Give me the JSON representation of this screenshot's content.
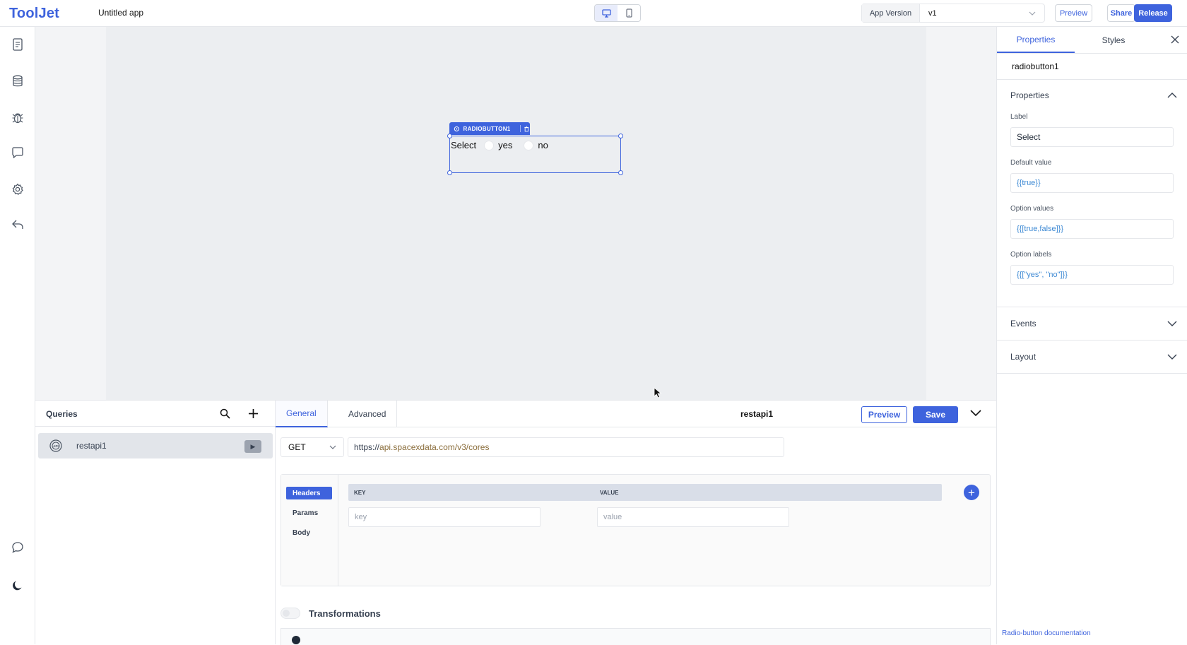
{
  "header": {
    "logo": "ToolJet",
    "app_name": "Untitled app",
    "app_version_label": "App Version",
    "app_version_value": "v1",
    "preview": "Preview",
    "share": "Share",
    "release": "Release"
  },
  "canvas": {
    "widget_tag": "RADIOBUTTON1",
    "radio": {
      "label": "Select",
      "options": [
        "yes",
        "no"
      ]
    }
  },
  "queries": {
    "title": "Queries",
    "items": [
      {
        "name": "restapi1",
        "icon": "api-icon"
      }
    ]
  },
  "editor": {
    "tabs": [
      "General",
      "Advanced"
    ],
    "query_name": "restapi1",
    "preview": "Preview",
    "save": "Save",
    "method": "GET",
    "url_protocol": "https://",
    "url_rest": "api.spacexdata.com/v3/cores",
    "kv_tabs": [
      "Headers",
      "Params",
      "Body"
    ],
    "kv_headers": [
      "KEY",
      "VALUE"
    ],
    "key_placeholder": "key",
    "value_placeholder": "value",
    "transformations": "Transformations"
  },
  "inspector": {
    "tabs": [
      "Properties",
      "Styles"
    ],
    "component_name": "radiobutton1",
    "section_properties": "Properties",
    "fields": [
      {
        "label": "Label",
        "value": "Select"
      },
      {
        "label": "Default value",
        "value": "{{true}}"
      },
      {
        "label": "Option values",
        "value": "{{[true,false]}}"
      },
      {
        "label": "Option labels",
        "value": "{{[\"yes\", \"no\"]}}"
      }
    ],
    "section_events": "Events",
    "section_layout": "Layout",
    "doc_link": "Radio-button documentation"
  },
  "colors": {
    "accent": "#3e63dd",
    "canvas": "#eceef1"
  }
}
